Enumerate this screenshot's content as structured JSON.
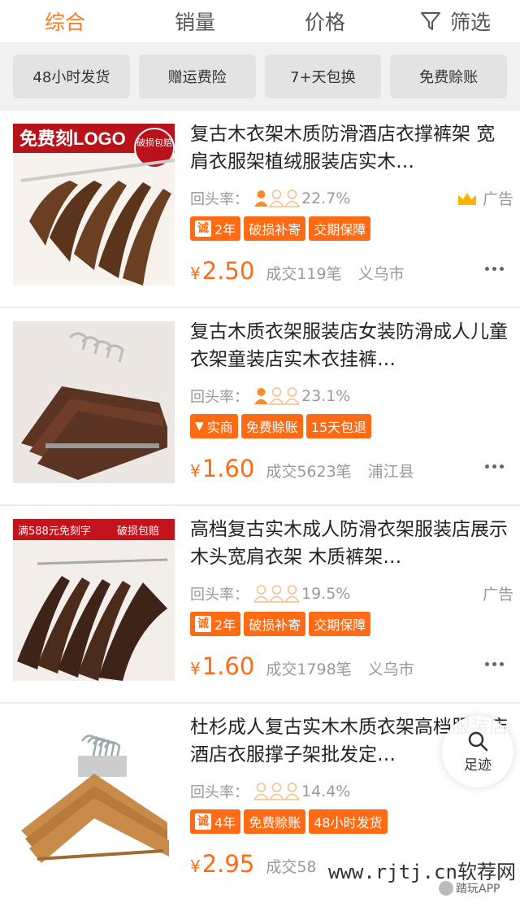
{
  "sort_tabs": [
    {
      "label": "综合",
      "active": true
    },
    {
      "label": "销量",
      "active": false
    },
    {
      "label": "价格",
      "active": false
    }
  ],
  "filter": {
    "label": "筛选",
    "icon": "filter-icon"
  },
  "quick_filters": [
    "48小时发货",
    "赠运费险",
    "7+天包换",
    "免费赊账"
  ],
  "products": [
    {
      "title": "复古木衣架木质防滑酒店衣撑裤架 宽肩衣服架植绒服装店实木…",
      "rate_label": "回头率：",
      "rate_value": "22.7%",
      "rate_level": 1,
      "ad_label": "广告",
      "ad_crown": true,
      "badges": [
        {
          "type": "cheng",
          "icon_text": "诚",
          "text": "2年"
        },
        {
          "type": "plain",
          "text": "破损补寄"
        },
        {
          "type": "plain",
          "text": "交期保障"
        }
      ],
      "yen": "¥",
      "price": "2.50",
      "sold": "成交119笔",
      "location": "义乌市",
      "image_banner": "免费刻LOGO",
      "image_seal": "破损包赔"
    },
    {
      "title": "复古木质衣架服装店女装防滑成人儿童衣架童装店实木衣挂裤…",
      "rate_label": "回头率：",
      "rate_value": "23.1%",
      "rate_level": 1,
      "ad_label": "",
      "ad_crown": false,
      "badges": [
        {
          "type": "shop",
          "text": "实商"
        },
        {
          "type": "plain",
          "text": "免费赊账"
        },
        {
          "type": "plain",
          "text": "15天包退"
        }
      ],
      "yen": "¥",
      "price": "1.60",
      "sold": "成交5623笔",
      "location": "浦江县"
    },
    {
      "title": "高档复古实木成人防滑衣架服装店展示木头宽肩衣架 木质裤架…",
      "rate_label": "回头率：",
      "rate_value": "19.5%",
      "rate_level": 0,
      "ad_label": "广告",
      "ad_crown": false,
      "badges": [
        {
          "type": "cheng",
          "icon_text": "诚",
          "text": "2年"
        },
        {
          "type": "plain",
          "text": "破损补寄"
        },
        {
          "type": "plain",
          "text": "交期保障"
        }
      ],
      "yen": "¥",
      "price": "1.60",
      "sold": "成交1798笔",
      "location": "义乌市",
      "image_banner": "满588元免刻字",
      "image_banner2": "破损包赔"
    },
    {
      "title": "杜杉成人复古实木木质衣架高档服装店酒店衣服撑子架批发定…",
      "rate_label": "回头率：",
      "rate_value": "14.4%",
      "rate_level": 0,
      "ad_label": "",
      "ad_crown": false,
      "badges": [
        {
          "type": "cheng",
          "icon_text": "诚",
          "text": "4年"
        },
        {
          "type": "plain",
          "text": "免费赊账"
        },
        {
          "type": "plain",
          "text": "48小时发货"
        }
      ],
      "yen": "¥",
      "price": "2.95",
      "sold": "成交58",
      "location": ""
    }
  ],
  "footprint": {
    "label": "足迹",
    "icon": "search-icon"
  },
  "watermark": {
    "text": "www.rjtj.cn软荐网",
    "app": "踏玩APP"
  },
  "colors": {
    "accent": "#ff6a14",
    "active_tab": "#ff7a1a",
    "muted": "#999999",
    "chip_bg": "#e3e3e3"
  }
}
